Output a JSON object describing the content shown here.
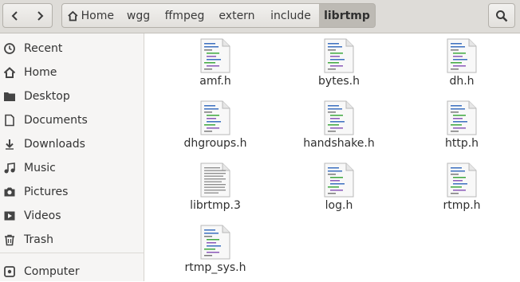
{
  "navigation": {
    "back_icon": "chevron-left-icon",
    "forward_icon": "chevron-right-icon"
  },
  "breadcrumb": {
    "home_icon": "home-icon",
    "segments": [
      "Home",
      "wgg",
      "ffmpeg",
      "extern",
      "include",
      "librtmp"
    ],
    "active_index": 5
  },
  "search_icon": "search-icon",
  "sidebar": {
    "items": [
      {
        "label": "Recent",
        "icon": "clock-icon"
      },
      {
        "label": "Home",
        "icon": "home-icon"
      },
      {
        "label": "Desktop",
        "icon": "folder-icon"
      },
      {
        "label": "Documents",
        "icon": "document-icon"
      },
      {
        "label": "Downloads",
        "icon": "download-icon"
      },
      {
        "label": "Music",
        "icon": "music-icon"
      },
      {
        "label": "Pictures",
        "icon": "camera-icon"
      },
      {
        "label": "Videos",
        "icon": "video-icon"
      },
      {
        "label": "Trash",
        "icon": "trash-icon"
      },
      {
        "label": "Computer",
        "icon": "drive-icon"
      }
    ]
  },
  "files": [
    {
      "name": "amf.h",
      "icon": "c-header-file-icon"
    },
    {
      "name": "bytes.h",
      "icon": "c-header-file-icon"
    },
    {
      "name": "dh.h",
      "icon": "c-header-file-icon"
    },
    {
      "name": "dhgroups.h",
      "icon": "c-header-file-icon"
    },
    {
      "name": "handshake.h",
      "icon": "c-header-file-icon"
    },
    {
      "name": "http.h",
      "icon": "c-header-file-icon"
    },
    {
      "name": "librtmp.3",
      "icon": "text-file-icon"
    },
    {
      "name": "log.h",
      "icon": "c-header-file-icon"
    },
    {
      "name": "rtmp.h",
      "icon": "c-header-file-icon"
    },
    {
      "name": "rtmp_sys.h",
      "icon": "c-header-file-icon"
    }
  ],
  "colors": {
    "header_bg": "#dedcd8",
    "active_crumb_bg": "#bdbab4",
    "sidebar_bg": "#f6f5f4"
  }
}
